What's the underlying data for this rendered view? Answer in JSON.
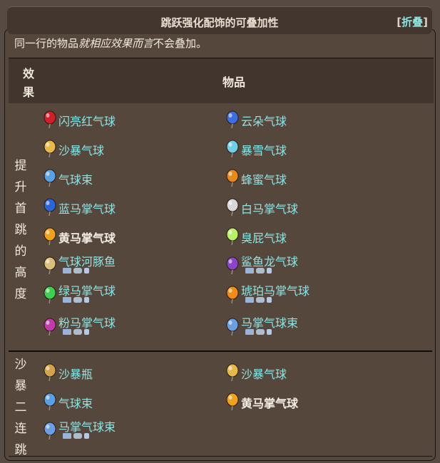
{
  "title": "跳跃强化配饰的可叠加性",
  "collapse": {
    "open": "[",
    "label": "折叠",
    "close": "]"
  },
  "desc": {
    "before": "同一行的物品",
    "italic": "就相应效果而言",
    "after": "不会叠加。"
  },
  "header": {
    "effect": "效果",
    "items": "物品"
  },
  "rows": [
    {
      "effect": "提升首跳的高度",
      "left": [
        {
          "label": "闪亮红气球",
          "icon": "red-balloon-icon"
        },
        {
          "label": "沙暴气球",
          "icon": "sandstorm-balloon-icon"
        },
        {
          "label": "气球束",
          "icon": "balloon-bundle-icon"
        },
        {
          "label": "蓝马掌气球",
          "icon": "blue-horseshoe-balloon-icon"
        },
        {
          "label": "黄马掌气球",
          "icon": "yellow-horseshoe-balloon-icon",
          "bold": true
        },
        {
          "label": "气球河豚鱼",
          "icon": "balloon-pufferfish-icon",
          "platforms": true
        },
        {
          "label": "绿马掌气球",
          "icon": "green-horseshoe-balloon-icon",
          "platforms": true
        },
        {
          "label": "粉马掌气球",
          "icon": "pink-horseshoe-balloon-icon",
          "platforms": true
        }
      ],
      "right": [
        {
          "label": "云朵气球",
          "icon": "cloud-balloon-icon"
        },
        {
          "label": "暴雪气球",
          "icon": "blizzard-balloon-icon"
        },
        {
          "label": "蜂蜜气球",
          "icon": "honey-balloon-icon"
        },
        {
          "label": "白马掌气球",
          "icon": "white-horseshoe-balloon-icon"
        },
        {
          "label": "臭屁气球",
          "icon": "fart-balloon-icon"
        },
        {
          "label": "鲨鱼龙气球",
          "icon": "sharkron-balloon-icon",
          "platforms": true
        },
        {
          "label": "琥珀马掌气球",
          "icon": "amber-horseshoe-balloon-icon",
          "platforms": true
        },
        {
          "label": "马掌气球束",
          "icon": "horseshoe-bundle-icon",
          "platforms": true
        }
      ]
    },
    {
      "effect": "沙暴二连跳",
      "left": [
        {
          "label": "沙暴瓶",
          "icon": "sandstorm-bottle-icon"
        },
        {
          "label": "气球束",
          "icon": "balloon-bundle-icon"
        },
        {
          "label": "马掌气球束",
          "icon": "horseshoe-bundle-icon",
          "platforms": true
        }
      ],
      "right": [
        {
          "label": "沙暴气球",
          "icon": "sandstorm-balloon-icon"
        },
        {
          "label": "黄马掌气球",
          "icon": "yellow-horseshoe-balloon-icon",
          "bold": true
        }
      ]
    }
  ]
}
